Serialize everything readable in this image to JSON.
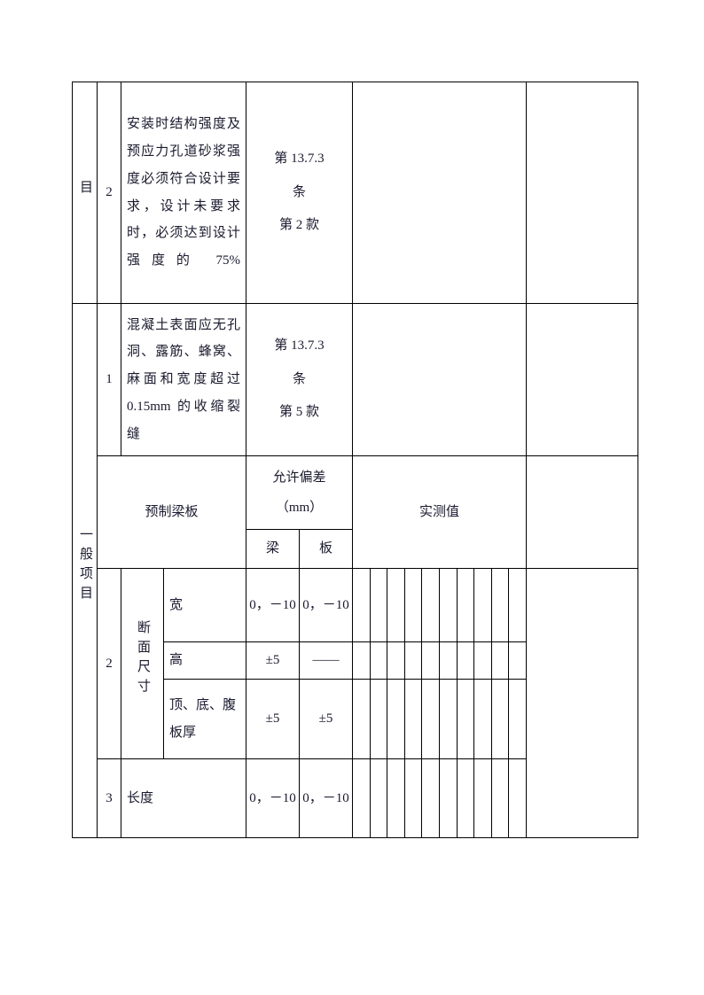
{
  "document": {
    "type": "inspection-record-table",
    "page_background": "#ffffff",
    "border_color": "#000000",
    "text_color": "#1a1a2e"
  },
  "table": {
    "rows": {
      "row_main_2": {
        "category_label": "目",
        "seq": "2",
        "content": "安装时结构强度及预应力孔道砂浆强度必须符合设计要求，设计未要求时，必须达到设计强度的 75%",
        "clause_line1": "第 13.7.3",
        "clause_line2": "条",
        "clause_line3": "第 2 款",
        "measured": "",
        "remark": ""
      },
      "row_main_1": {
        "seq": "1",
        "content": "混凝土表面应无孔洞、露筋、蜂窝、麻面和宽度超过 0.15mm 的收缩裂缝",
        "clause_line1": "第 13.7.3",
        "clause_line2": "条",
        "clause_line3": "第 5 款",
        "measured": "",
        "remark": ""
      }
    },
    "general_section": {
      "category_label": "一般项目",
      "header": {
        "item_title": "预制梁板",
        "tolerance_title_line1": "允许偏差",
        "tolerance_title_line2": "（mm）",
        "tolerance_sub_beam": "梁",
        "tolerance_sub_slab": "板",
        "measured_title": "实测值"
      },
      "rows": [
        {
          "seq": "2",
          "group_label": "断面尺寸",
          "sub_items": [
            {
              "name": "宽",
              "beam": "0，－10",
              "slab": "0，－10"
            },
            {
              "name": "高",
              "beam": "±5",
              "slab": "——"
            },
            {
              "name": "顶、底、腹板厚",
              "beam": "±5",
              "slab": "±5"
            }
          ]
        },
        {
          "seq": "3",
          "group_label": "",
          "name": "长度",
          "beam": "0，－10",
          "slab": "0，－10"
        }
      ],
      "measured_column_count": 10
    }
  }
}
